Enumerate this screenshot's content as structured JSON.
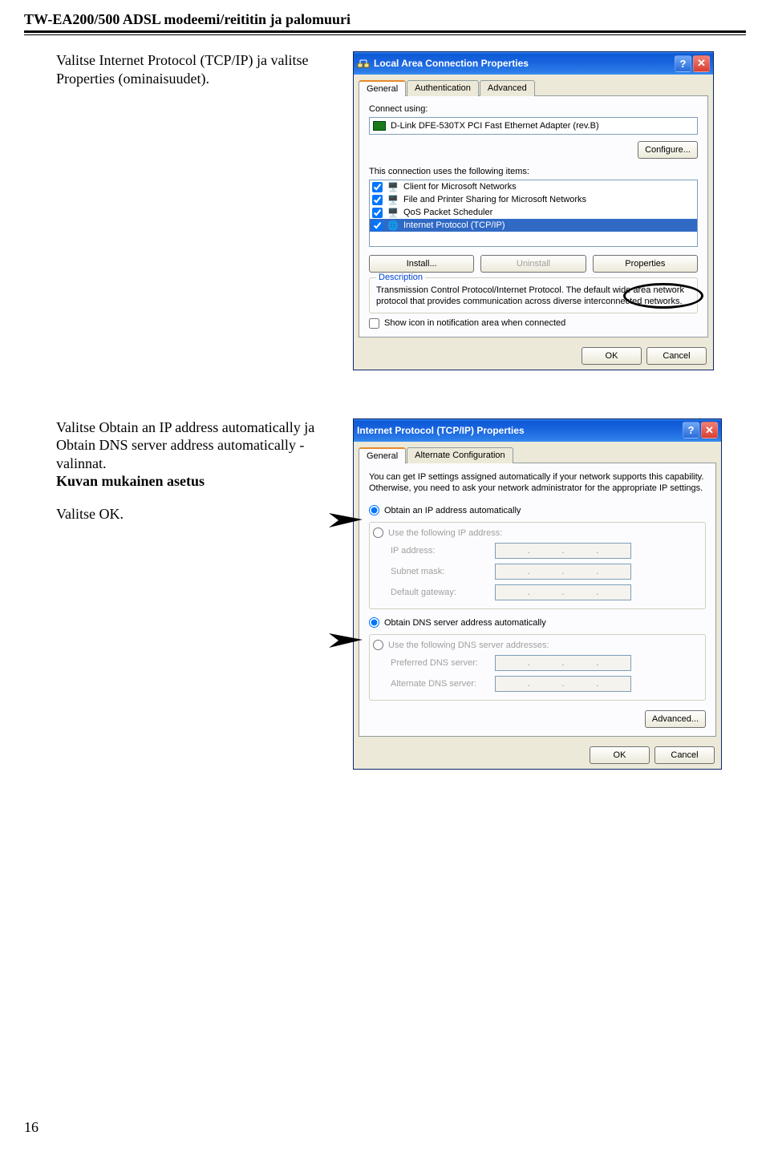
{
  "page": {
    "header": "TW-EA200/500 ADSL modeemi/reititin ja palomuuri",
    "number": "16"
  },
  "instr1": "Valitse Internet Protocol (TCP/IP) ja valitse Properties (ominaisuudet).",
  "instr2a": "Valitse Obtain an IP address automatically ja Obtain DNS server address automatically -valinnat.",
  "instr2b": "Kuvan mukainen asetus",
  "instr2c": "Valitse OK.",
  "dlg1": {
    "title": "Local Area Connection Properties",
    "tabs": [
      "General",
      "Authentication",
      "Advanced"
    ],
    "connect_using_label": "Connect using:",
    "adapter": "D-Link DFE-530TX PCI Fast Ethernet Adapter (rev.B)",
    "configure": "Configure...",
    "items_label": "This connection uses the following items:",
    "items": [
      "Client for Microsoft Networks",
      "File and Printer Sharing for Microsoft Networks",
      "QoS Packet Scheduler",
      "Internet Protocol (TCP/IP)"
    ],
    "install": "Install...",
    "uninstall": "Uninstall",
    "properties": "Properties",
    "desc_legend": "Description",
    "desc": "Transmission Control Protocol/Internet Protocol. The default wide area network protocol that provides communication across diverse interconnected networks.",
    "show_icon": "Show icon in notification area when connected",
    "ok": "OK",
    "cancel": "Cancel"
  },
  "dlg2": {
    "title": "Internet Protocol (TCP/IP) Properties",
    "tabs": [
      "General",
      "Alternate Configuration"
    ],
    "intro": "You can get IP settings assigned automatically if your network supports this capability. Otherwise, you need to ask your network administrator for the appropriate IP settings.",
    "r1": "Obtain an IP address automatically",
    "r2": "Use the following IP address:",
    "ip": "IP address:",
    "subnet": "Subnet mask:",
    "gw": "Default gateway:",
    "r3": "Obtain DNS server address automatically",
    "r4": "Use the following DNS server addresses:",
    "pdns": "Preferred DNS server:",
    "adns": "Alternate DNS server:",
    "advanced": "Advanced...",
    "ok": "OK",
    "cancel": "Cancel"
  }
}
